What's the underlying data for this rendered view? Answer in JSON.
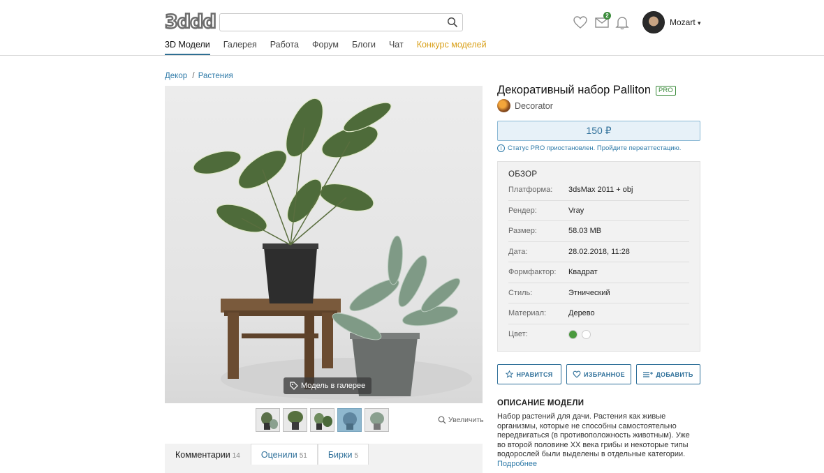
{
  "header": {
    "logo": "3ddd",
    "search_placeholder": "",
    "notifications_badge": "2",
    "username": "Mozart",
    "user_chevron": "▾",
    "icons": [
      "search-icon",
      "heart-icon",
      "mail-icon",
      "bell-icon",
      "chevron-down-icon"
    ]
  },
  "nav": {
    "items": [
      {
        "label": "3D Модели"
      },
      {
        "label": "Галерея"
      },
      {
        "label": "Работа"
      },
      {
        "label": "Форум"
      },
      {
        "label": "Блоги"
      },
      {
        "label": "Чат"
      },
      {
        "label": "Конкурс моделей"
      }
    ]
  },
  "breadcrumb": {
    "part1": "Декор",
    "sep": "/",
    "part2": "Растения"
  },
  "gallery": {
    "button_label": "Модель в галерее",
    "zoom_label": "Увеличить",
    "thumb_count": 5,
    "selected_thumb": 4
  },
  "tabs": [
    {
      "label": "Комментарии",
      "count": "14"
    },
    {
      "label": "Оценили",
      "count": "51"
    },
    {
      "label": "Бирки",
      "count": "5"
    }
  ],
  "product": {
    "title": "Декоративный набор Palliton",
    "pro": "PRO",
    "author": "Decorator",
    "price": "150 ₽",
    "status": "Статус PRO приостановлен. Пройдите переаттестацию."
  },
  "overview": {
    "title": "ОБЗОР",
    "rows": [
      {
        "k": "Платформа:",
        "v": "3dsMax 2011 + obj"
      },
      {
        "k": "Рендер:",
        "v": "Vray"
      },
      {
        "k": "Размер:",
        "v": "58.03 MB"
      },
      {
        "k": "Дата:",
        "v": "28.02.2018, 11:28"
      },
      {
        "k": "Формфактор:",
        "v": "Квадрат"
      },
      {
        "k": "Стиль:",
        "v": "Этнический"
      },
      {
        "k": "Материал:",
        "v": "Дерево"
      },
      {
        "k": "Цвет:",
        "v": ""
      }
    ],
    "colors": [
      "#4a9a3e",
      "#ffffff"
    ]
  },
  "actions": {
    "like": "НРАВИТСЯ",
    "favorite": "ИЗБРАННОЕ",
    "add": "ДОБАВИТЬ"
  },
  "description": {
    "title": "ОПИСАНИЕ МОДЕЛИ",
    "text": "Набор растений для дачи. Растения как живые организмы, которые не способны самостоятельно передвигаться (в противоположность животным). Уже во второй половине XX века грибы и некоторые типы водорослей были выделены в отдельные категории.",
    "more": "Подробнее"
  }
}
